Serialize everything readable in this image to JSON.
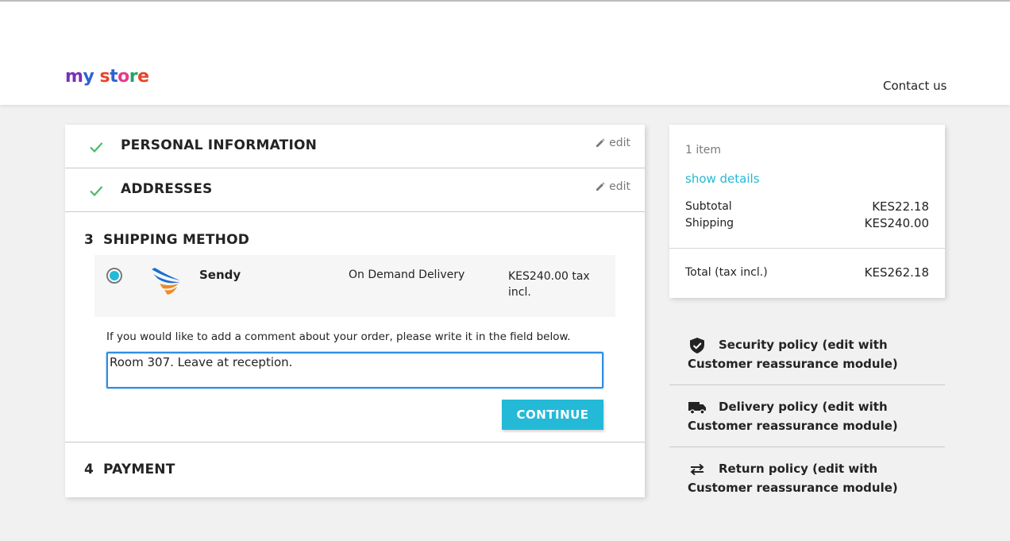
{
  "header": {
    "logo_letters": [
      {
        "ch": "m",
        "color": "#7b2fb4"
      },
      {
        "ch": "y",
        "color": "#2a64d4"
      },
      {
        "ch": " ",
        "color": "#000000"
      },
      {
        "ch": "s",
        "color": "#e8442a"
      },
      {
        "ch": "t",
        "color": "#2a64d4"
      },
      {
        "ch": "o",
        "color": "#e83a8c"
      },
      {
        "ch": "r",
        "color": "#1aa86a"
      },
      {
        "ch": "e",
        "color": "#e8442a"
      }
    ],
    "contact_label": "Contact us"
  },
  "steps": {
    "personal": {
      "title": "PERSONAL INFORMATION",
      "edit": "edit"
    },
    "addresses": {
      "title": "ADDRESSES",
      "edit": "edit"
    },
    "shipping": {
      "number": "3",
      "title": "SHIPPING METHOD"
    },
    "payment": {
      "number": "4",
      "title": "PAYMENT"
    }
  },
  "carrier": {
    "name": "Sendy",
    "delay": "On Demand Delivery",
    "price": "KES240.00 tax incl.",
    "selected": true
  },
  "comment": {
    "label": "If you would like to add a comment about your order, please write it in the field below.",
    "value": "Room 307. Leave at reception."
  },
  "continue_label": "CONTINUE",
  "summary": {
    "items": "1 item",
    "show_details": "show details",
    "subtotal_label": "Subtotal",
    "subtotal_value": "KES22.18",
    "shipping_label": "Shipping",
    "shipping_value": "KES240.00",
    "total_label": "Total (tax incl.)",
    "total_value": "KES262.18"
  },
  "reassurance": [
    {
      "icon": "shield-check-icon",
      "text": "Security policy (edit with Customer reassurance module)"
    },
    {
      "icon": "truck-icon",
      "text": "Delivery policy (edit with Customer reassurance module)"
    },
    {
      "icon": "swap-arrows-icon",
      "text": "Return policy (edit with Customer reassurance module)"
    }
  ],
  "colors": {
    "accent": "#24b9d7",
    "check": "#4cbb6c",
    "focus_border": "#2f8ee6"
  }
}
